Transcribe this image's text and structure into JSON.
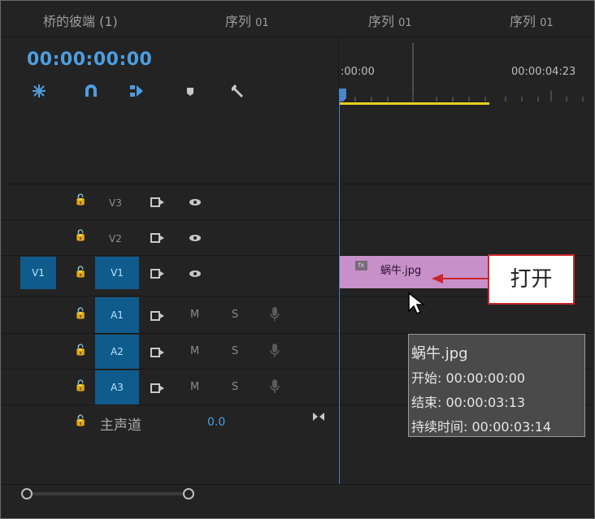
{
  "tabs": [
    {
      "label": "桥的彼端 (1)"
    },
    {
      "label": "序列",
      "num": "01"
    },
    {
      "label": "序列",
      "num": "01"
    },
    {
      "label": "序列",
      "num": "01"
    }
  ],
  "timecode": "00:00:00:00",
  "ruler": {
    "start": ":00:00",
    "mark": "00:00:04:23"
  },
  "video_tracks": [
    {
      "label": "V3",
      "source_patch": ""
    },
    {
      "label": "V2",
      "source_patch": ""
    },
    {
      "label": "V1",
      "source_patch": "V1"
    }
  ],
  "audio_tracks": [
    {
      "label": "A1",
      "mute": "M",
      "solo": "S"
    },
    {
      "label": "A2",
      "mute": "M",
      "solo": "S"
    },
    {
      "label": "A3",
      "mute": "M",
      "solo": "S"
    }
  ],
  "master": {
    "label": "主声道",
    "value": "0.0"
  },
  "clip": {
    "name": "蜗牛.jpg",
    "fx": "fx"
  },
  "callout": "打开",
  "tooltip": {
    "name": "蜗牛.jpg",
    "start": "开始: 00:00:00:00",
    "end": "结束: 00:00:03:13",
    "duration": "持续时间: 00:00:03:14"
  },
  "colors": {
    "accent": "#4d9ee0",
    "clip": "#c890c8",
    "track_target": "#0f5c8c",
    "callout_border": "#c8262a",
    "work_area": "#e8d020"
  }
}
